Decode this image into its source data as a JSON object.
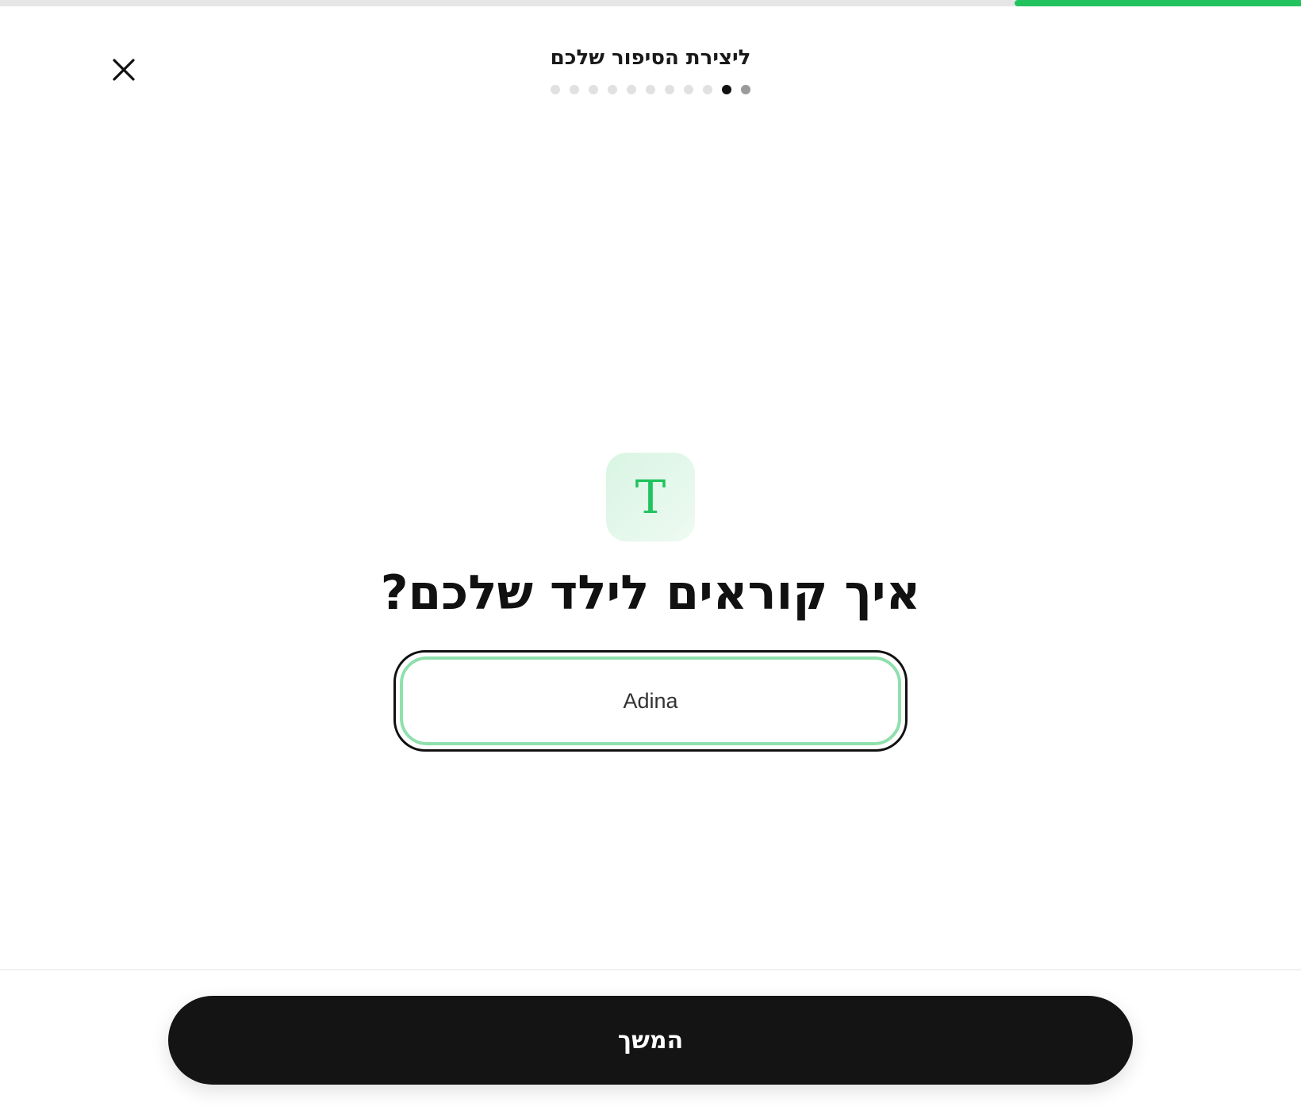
{
  "progress": {
    "fraction": 0.22,
    "accent_color": "#22c35e"
  },
  "header": {
    "close_icon": "close-icon",
    "title": "ליצירת הסיפור שלכם",
    "steps": {
      "total": 11,
      "current_index": 9,
      "completed_index": 10
    }
  },
  "main": {
    "icon": "text-t-icon",
    "icon_glyph": "T",
    "question": "איך קוראים לילד שלכם?",
    "name_input": {
      "value": "Adina",
      "placeholder": ""
    }
  },
  "footer": {
    "continue_label": "המשך"
  }
}
